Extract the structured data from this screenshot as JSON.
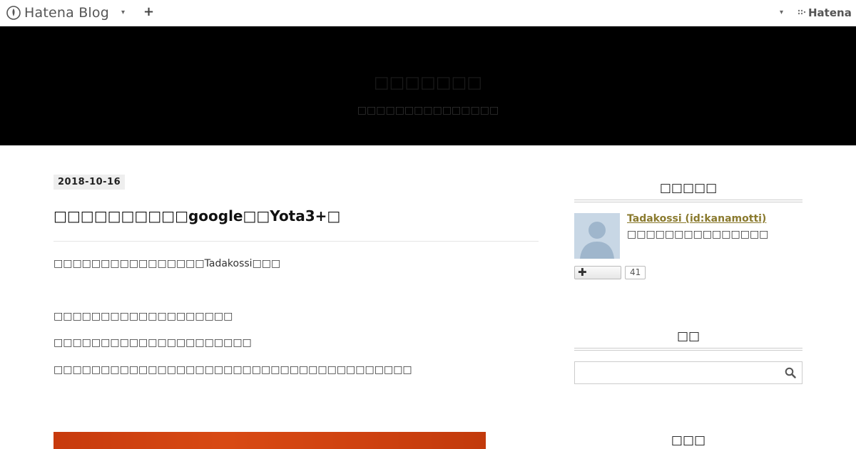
{
  "navbar": {
    "logo_text": "Hatena Blog",
    "brand_text": "Hatena",
    "left_menu_caret": "▾",
    "add_button": "+",
    "right_menu_caret": "▾"
  },
  "header": {
    "blog_title": "□□□□□□□",
    "blog_description": "□□□□□□□□□□□□□□□"
  },
  "entry": {
    "date": "2018-10-16",
    "title": "□□□□□□□□□□google□□Yota3+□",
    "paragraphs": [
      "□□□□□□□□□□□□□□□□Tadakossi□□□",
      "□□□□□□□□□□□□□□□□□□□",
      "□□□□□□□□□□□□□□□□□□□□□",
      "□□□□□□□□□□□□□□□□□□□□□□□□□□□□□□□□□□□□□□"
    ]
  },
  "sidebar": {
    "profile_heading": "□□□□□",
    "profile_name": "Tadakossi (id:kanamotti)",
    "profile_description": "□□□□□□□□□□□□□□□",
    "follower_count": "41",
    "search_heading": "□□",
    "search_placeholder": "",
    "next_heading": "□□□"
  },
  "colors": {
    "banner_background": "#000000",
    "profile_link": "#8a7a2e",
    "image_accent": "#d84a14"
  },
  "icons": {
    "logo": "hatena-blog-pen-icon",
    "brand": "hatena-dots-icon",
    "add": "plus-icon",
    "search": "search-icon",
    "avatar": "default-user-avatar-icon"
  }
}
